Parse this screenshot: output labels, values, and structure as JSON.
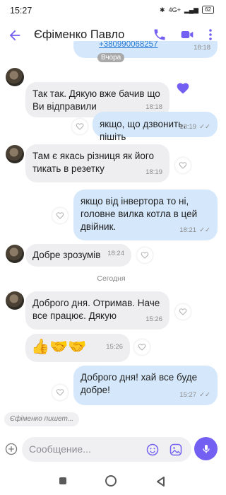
{
  "status_bar": {
    "time": "15:27",
    "network": "4G+",
    "battery": "62"
  },
  "header": {
    "contact_name": "Єфіменко Павло"
  },
  "chat": {
    "top_partial": {
      "text": "+380990068257",
      "time": "18:18",
      "date_badge": "Вчора"
    },
    "messages": [
      {
        "dir": "in",
        "text": "Так так. Дякую вже бачив що Ви відправили",
        "time": "18:18"
      },
      {
        "dir": "out",
        "text": "якщо, що дзвонить, пішіть",
        "time": "18:19"
      },
      {
        "dir": "in",
        "text": "Там є якась різниця як його тикать в резетку",
        "time": "18:19"
      },
      {
        "dir": "out",
        "text": "якщо від інвертора то ні, головне вилка котла в цей двійник.",
        "time": "18:21"
      },
      {
        "dir": "in",
        "text": "Добре зрозумів",
        "time": "18:24"
      },
      {
        "dir": "in",
        "text": "Доброго дня. Отримав. Наче все працює. Дякую",
        "time": "15:26"
      },
      {
        "dir": "in",
        "text": "👍🤝🤝",
        "time": "15:26"
      },
      {
        "dir": "out",
        "text": "Доброго дня! хай все буде добре!",
        "time": "15:27"
      }
    ],
    "date_separator": "Сегодня",
    "typing_indicator": "Єфіменко пишет..."
  },
  "composer": {
    "placeholder": "Сообщение..."
  },
  "colors": {
    "accent": "#7360f2",
    "incoming": "#eeeef0",
    "outgoing": "#d5e8fb"
  }
}
